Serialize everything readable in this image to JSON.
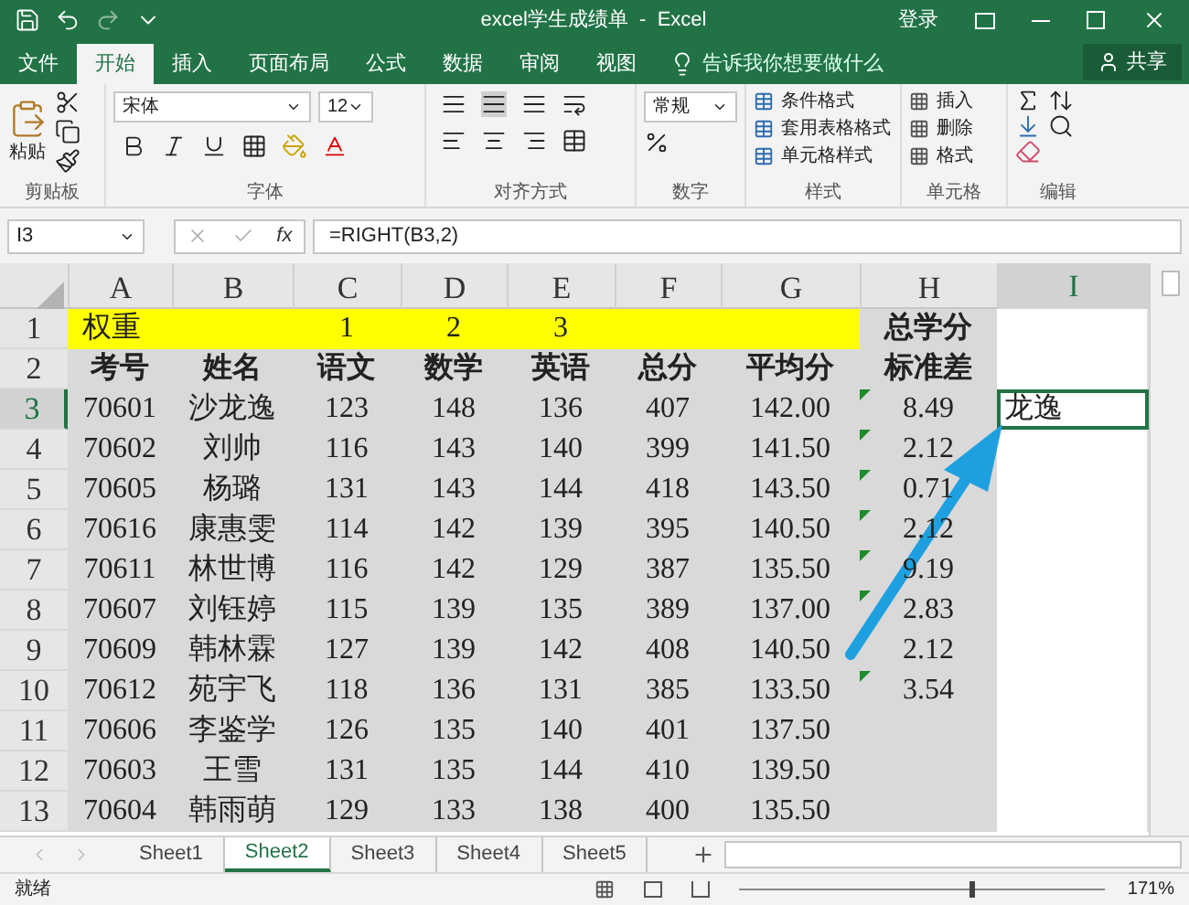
{
  "title_bar": {
    "title": "excel学生成绩单  -  Excel",
    "login": "登录"
  },
  "menu_tabs": [
    {
      "label": "文件",
      "selected": false
    },
    {
      "label": "开始",
      "selected": true
    },
    {
      "label": "插入",
      "selected": false
    },
    {
      "label": "页面布局",
      "selected": false
    },
    {
      "label": "公式",
      "selected": false
    },
    {
      "label": "数据",
      "selected": false
    },
    {
      "label": "审阅",
      "selected": false
    },
    {
      "label": "视图",
      "selected": false
    }
  ],
  "tell_me": "告诉我你想要做什么",
  "share": "共享",
  "ribbon": {
    "paste": "粘贴",
    "font_name": "宋体",
    "font_size": "12",
    "number_format": "常规",
    "style_buttons": [
      "条件格式",
      "套用表格格式",
      "单元格样式"
    ],
    "cell_buttons": [
      "插入",
      "删除",
      "格式"
    ],
    "groups": [
      "剪贴板",
      "字体",
      "对齐方式",
      "数字",
      "样式",
      "单元格",
      "编辑"
    ]
  },
  "formula_bar": {
    "name_box": "I3",
    "function_label": "fx",
    "formula": "=RIGHT(B3,2)"
  },
  "columns": [
    {
      "label": "A",
      "selected": false
    },
    {
      "label": "B",
      "selected": false
    },
    {
      "label": "C",
      "selected": false
    },
    {
      "label": "D",
      "selected": false
    },
    {
      "label": "E",
      "selected": false
    },
    {
      "label": "F",
      "selected": false
    },
    {
      "label": "G",
      "selected": false
    },
    {
      "label": "H",
      "selected": false
    },
    {
      "label": "I",
      "selected": true
    }
  ],
  "rows": [
    {
      "number": "1",
      "kind": "weight",
      "selected": false,
      "error_flag": false,
      "cells": [
        "权重",
        "",
        "1",
        "2",
        "3",
        "",
        "",
        "总学分",
        ""
      ]
    },
    {
      "number": "2",
      "kind": "header",
      "selected": false,
      "error_flag": false,
      "cells": [
        "考号",
        "姓名",
        "语文",
        "数学",
        "英语",
        "总分",
        "平均分",
        "标准差",
        ""
      ]
    },
    {
      "number": "3",
      "kind": "data",
      "selected": true,
      "error_flag": true,
      "cells": [
        "70601",
        "沙龙逸",
        "123",
        "148",
        "136",
        "407",
        "142.00",
        "8.49",
        "龙逸"
      ]
    },
    {
      "number": "4",
      "kind": "data",
      "selected": false,
      "error_flag": true,
      "cells": [
        "70602",
        "刘帅",
        "116",
        "143",
        "140",
        "399",
        "141.50",
        "2.12",
        ""
      ]
    },
    {
      "number": "5",
      "kind": "data",
      "selected": false,
      "error_flag": true,
      "cells": [
        "70605",
        "杨璐",
        "131",
        "143",
        "144",
        "418",
        "143.50",
        "0.71",
        ""
      ]
    },
    {
      "number": "6",
      "kind": "data",
      "selected": false,
      "error_flag": true,
      "cells": [
        "70616",
        "康惠雯",
        "114",
        "142",
        "139",
        "395",
        "140.50",
        "2.12",
        ""
      ]
    },
    {
      "number": "7",
      "kind": "data",
      "selected": false,
      "error_flag": true,
      "cells": [
        "70611",
        "林世博",
        "116",
        "142",
        "129",
        "387",
        "135.50",
        "9.19",
        ""
      ]
    },
    {
      "number": "8",
      "kind": "data",
      "selected": false,
      "error_flag": true,
      "cells": [
        "70607",
        "刘钰婷",
        "115",
        "139",
        "135",
        "389",
        "137.00",
        "2.83",
        ""
      ]
    },
    {
      "number": "9",
      "kind": "data",
      "selected": false,
      "error_flag": false,
      "cells": [
        "70609",
        "韩林霖",
        "127",
        "139",
        "142",
        "408",
        "140.50",
        "2.12",
        ""
      ]
    },
    {
      "number": "10",
      "kind": "data",
      "selected": false,
      "error_flag": true,
      "cells": [
        "70612",
        "苑宇飞",
        "118",
        "136",
        "131",
        "385",
        "133.50",
        "3.54",
        ""
      ]
    },
    {
      "number": "11",
      "kind": "data",
      "selected": false,
      "error_flag": false,
      "cells": [
        "70606",
        "李鉴学",
        "126",
        "135",
        "140",
        "401",
        "137.50",
        "",
        ""
      ]
    },
    {
      "number": "12",
      "kind": "data",
      "selected": false,
      "error_flag": false,
      "cells": [
        "70603",
        "王雪",
        "131",
        "135",
        "144",
        "410",
        "139.50",
        "",
        ""
      ]
    },
    {
      "number": "13",
      "kind": "data",
      "selected": false,
      "error_flag": false,
      "cells": [
        "70604",
        "韩雨萌",
        "129",
        "133",
        "138",
        "400",
        "135.50",
        "",
        ""
      ]
    }
  ],
  "sheets": [
    {
      "label": "Sheet1",
      "selected": false
    },
    {
      "label": "Sheet2",
      "selected": true
    },
    {
      "label": "Sheet3",
      "selected": false
    },
    {
      "label": "Sheet4",
      "selected": false
    },
    {
      "label": "Sheet5",
      "selected": false
    }
  ],
  "status_bar": {
    "status": "就绪",
    "zoom": "171%",
    "zoom_slider": {
      "level": 0.63
    }
  }
}
